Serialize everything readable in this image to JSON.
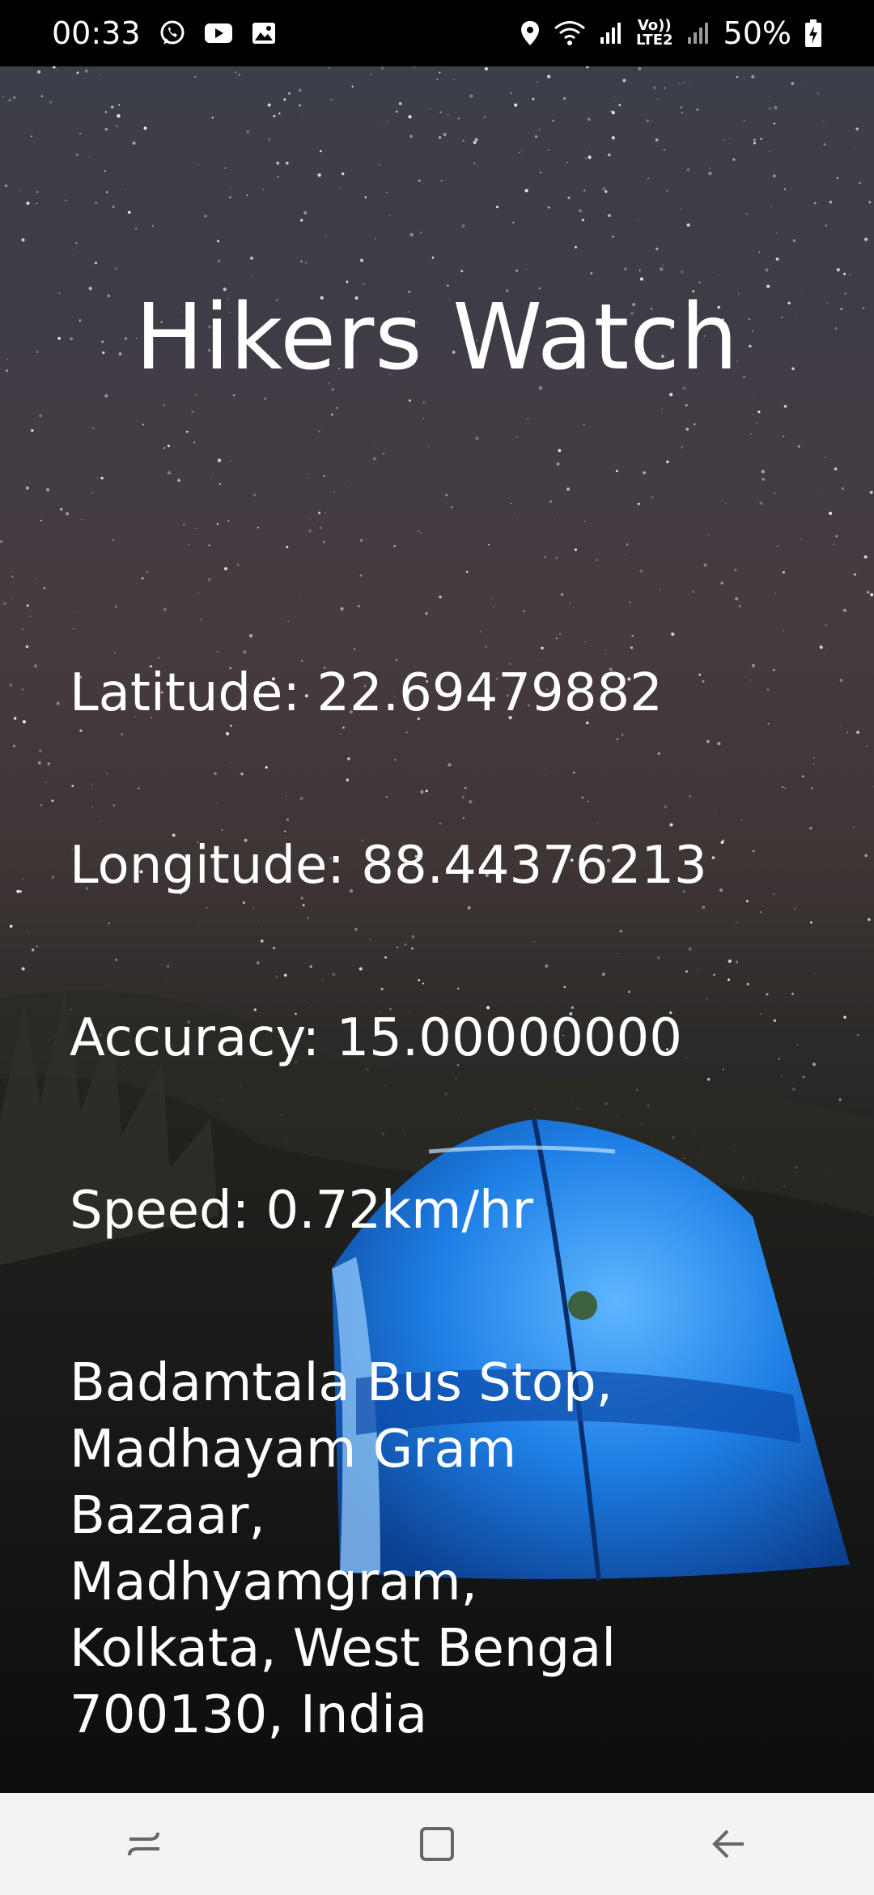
{
  "status_bar": {
    "time": "00:33",
    "left_icons": [
      "whatsapp-icon",
      "youtube-icon",
      "gallery-icon"
    ],
    "right_icons": [
      "location-icon",
      "wifi-icon",
      "signal-icon",
      "volte-lte2-icon",
      "signal-icon",
      "battery-charging-icon"
    ],
    "volte_label_top": "Vo))",
    "volte_label_bottom": "LTE2",
    "battery": "50%"
  },
  "app": {
    "title": "Hikers Watch",
    "latitude": "Latitude: 22.69479882",
    "longitude": "Longitude: 88.44376213",
    "accuracy": "Accuracy: 15.00000000",
    "speed": "Speed: 0.72km/hr",
    "address": "Badamtala Bus Stop, Madhayam Gram Bazaar, Madhyamgram, Kolkata, West Bengal 700130, India"
  },
  "nav_bar": {
    "buttons": [
      "recents-icon",
      "home-icon",
      "back-icon"
    ]
  },
  "colors": {
    "text": "#ffffff",
    "nav_background": "#f3f3f3",
    "tent_blue": "#1e7fe6"
  }
}
